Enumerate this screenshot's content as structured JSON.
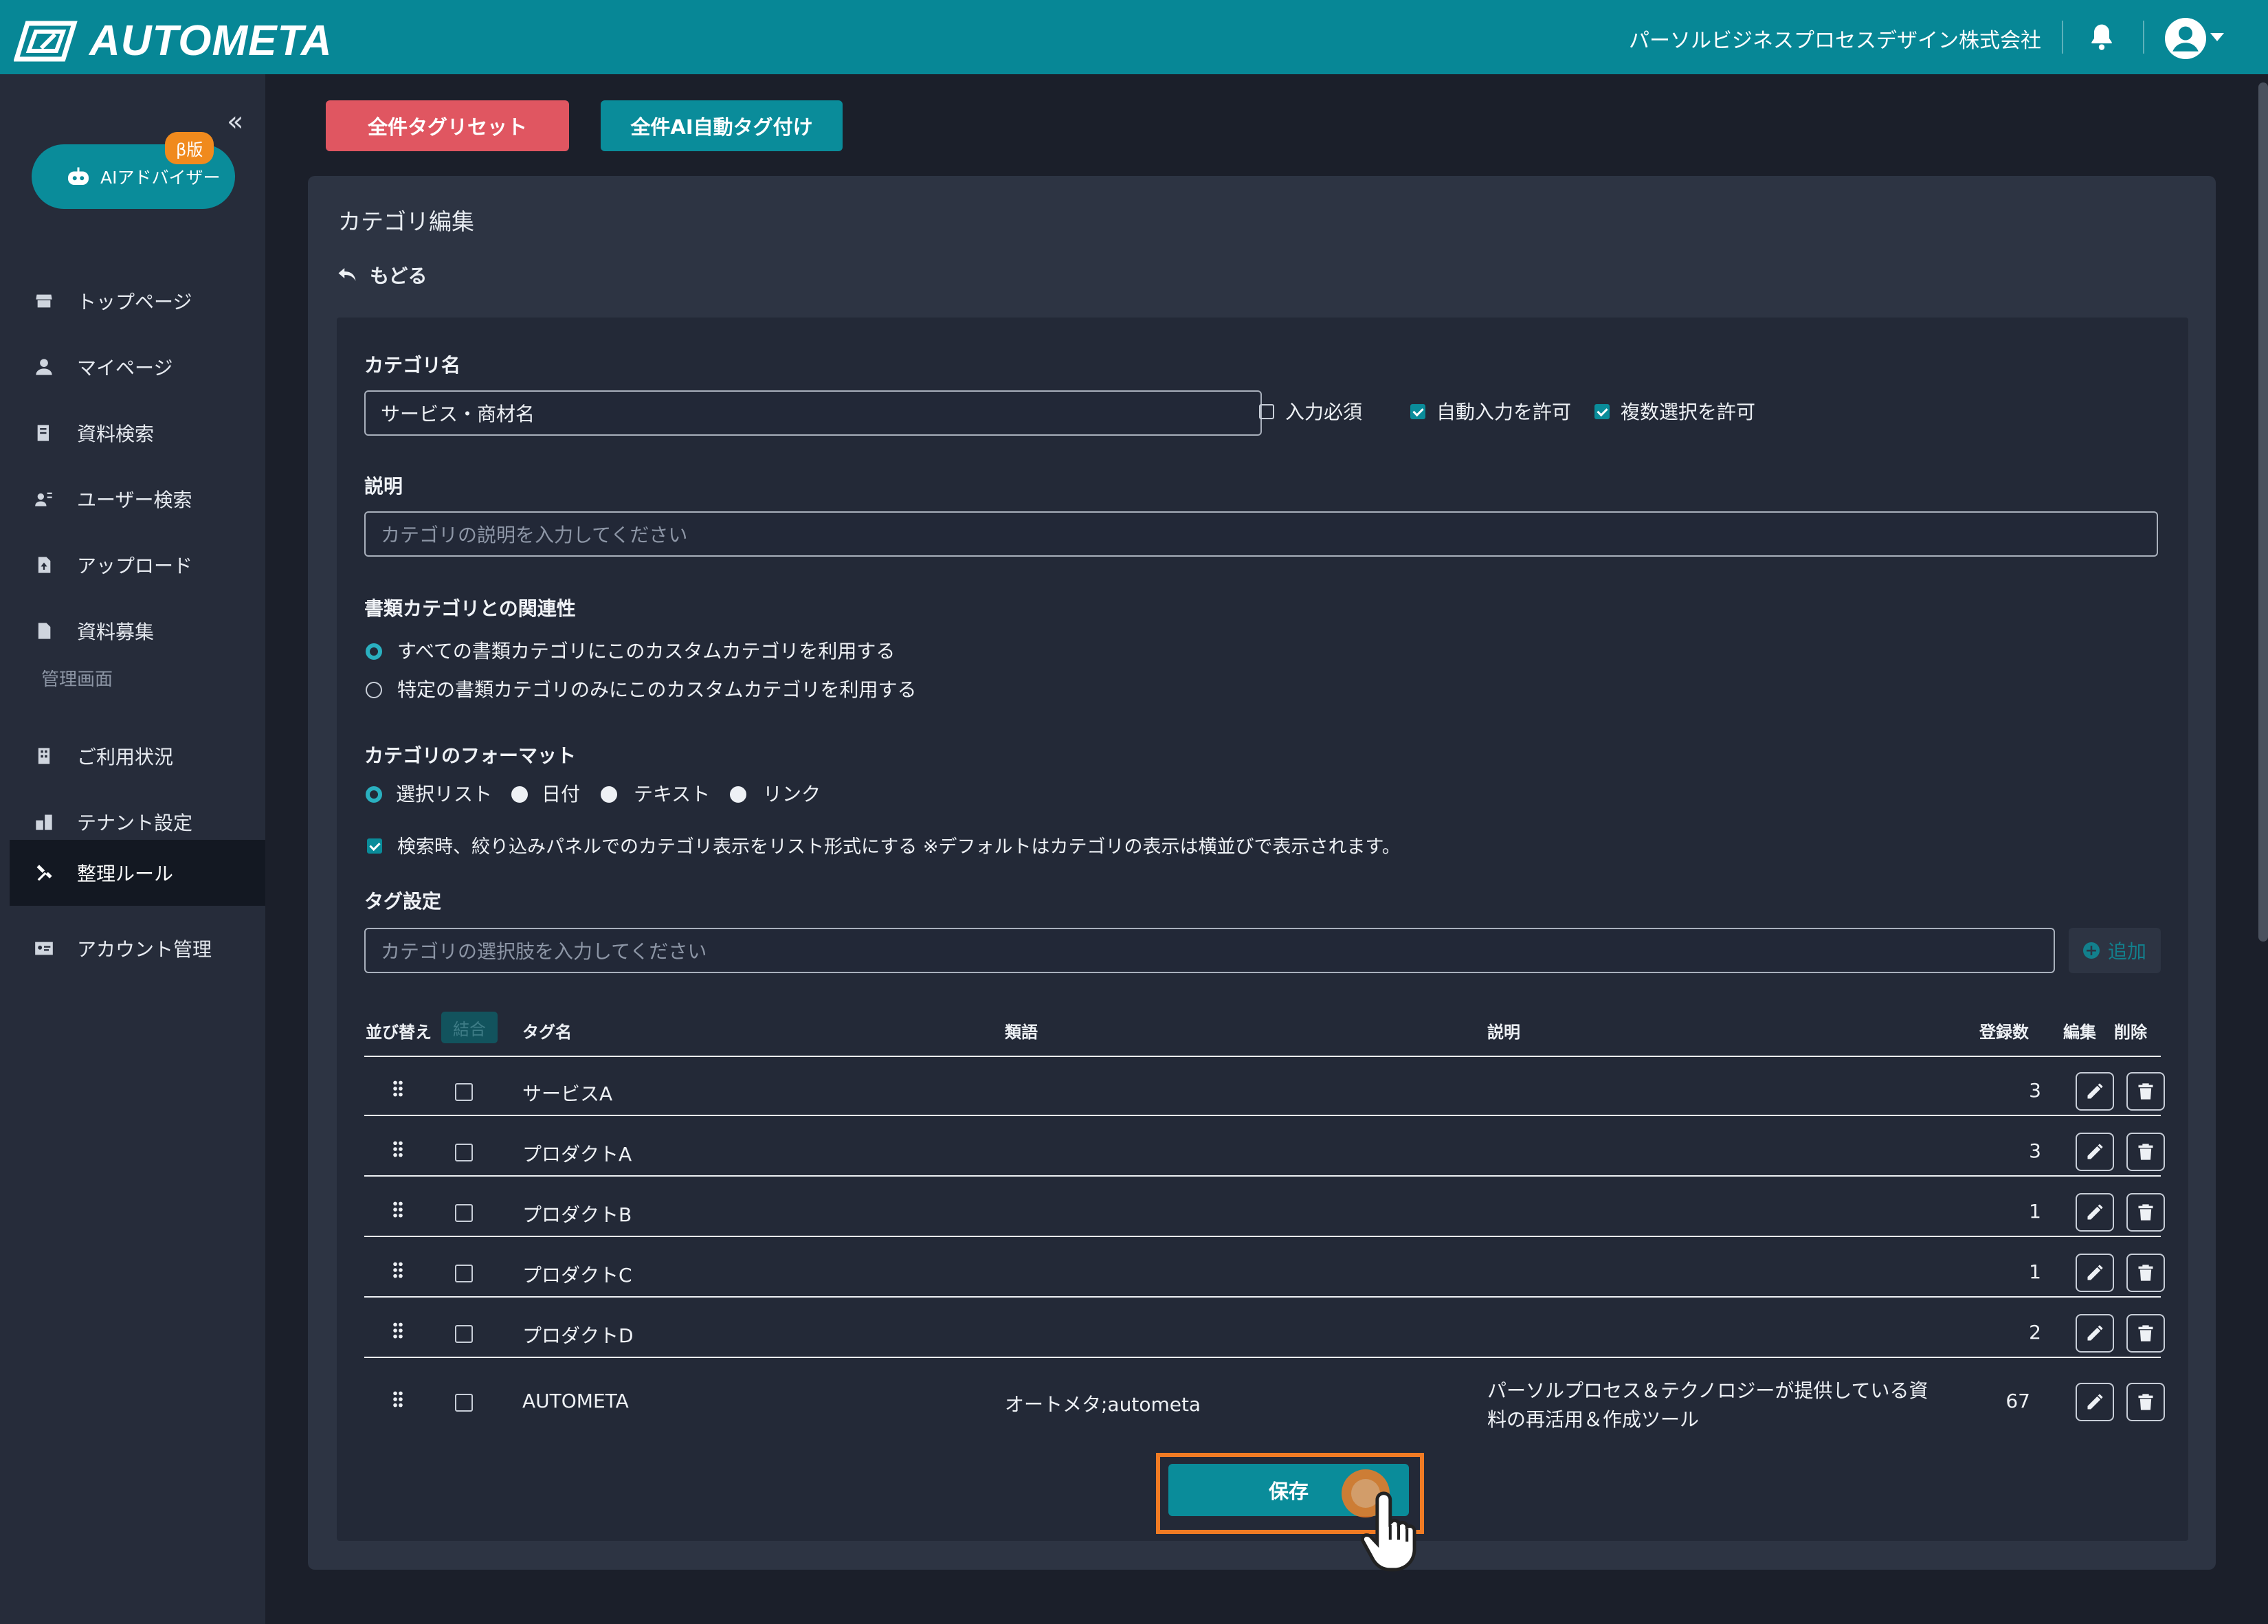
{
  "header": {
    "logo_text": "AUTOMETA",
    "company": "パーソルビジネスプロセスデザイン株式会社"
  },
  "sidebar": {
    "ai_button": "AIアドバイザー",
    "beta_badge": "β版",
    "items": [
      {
        "label": "トップページ"
      },
      {
        "label": "マイページ"
      },
      {
        "label": "資料検索"
      },
      {
        "label": "ユーザー検索"
      },
      {
        "label": "アップロード"
      },
      {
        "label": "資料募集"
      }
    ],
    "admin_section": "管理画面",
    "admin_items": [
      {
        "label": "ご利用状況"
      },
      {
        "label": "テナント設定"
      },
      {
        "label": "整理ルール",
        "active": true
      },
      {
        "label": "アカウント管理"
      }
    ]
  },
  "toolbar": {
    "reset_label": "全件タグリセット",
    "ai_tag_label": "全件AI自動タグ付け"
  },
  "panel": {
    "title": "カテゴリ編集",
    "back": "もどる"
  },
  "form": {
    "category_name_label": "カテゴリ名",
    "category_name_value": "サービス・商材名",
    "required_label": "入力必須",
    "required_checked": false,
    "auto_input_label": "自動入力を許可",
    "auto_input_checked": true,
    "multi_select_label": "複数選択を許可",
    "multi_select_checked": true,
    "description_label": "説明",
    "description_placeholder": "カテゴリの説明を入力してください",
    "relation_label": "書類カテゴリとの関連性",
    "relation_options": [
      {
        "label": "すべての書類カテゴリにこのカスタムカテゴリを利用する",
        "selected": true
      },
      {
        "label": "特定の書類カテゴリのみにこのカスタムカテゴリを利用する",
        "selected": false
      }
    ],
    "format_label": "カテゴリのフォーマット",
    "format_options": [
      {
        "label": "選択リスト",
        "selected": true
      },
      {
        "label": "日付",
        "selected": false
      },
      {
        "label": "テキスト",
        "selected": false
      },
      {
        "label": "リンク",
        "selected": false
      }
    ],
    "list_display_label": "検索時、絞り込みパネルでのカテゴリ表示をリスト形式にする ※デフォルトはカテゴリの表示は横並びで表示されます。",
    "list_display_checked": true,
    "tag_settings_label": "タグ設定",
    "tag_input_placeholder": "カテゴリの選択肢を入力してください",
    "add_label": "追加",
    "save_label": "保存"
  },
  "table": {
    "headers": {
      "sort": "並び替え",
      "merge": "結合",
      "tag_name": "タグ名",
      "synonym": "類語",
      "description": "説明",
      "count": "登録数",
      "edit": "編集",
      "delete": "削除"
    },
    "rows": [
      {
        "tag": "サービスA",
        "synonym": "",
        "description": "",
        "count": "3"
      },
      {
        "tag": "プロダクトA",
        "synonym": "",
        "description": "",
        "count": "3"
      },
      {
        "tag": "プロダクトB",
        "synonym": "",
        "description": "",
        "count": "1"
      },
      {
        "tag": "プロダクトC",
        "synonym": "",
        "description": "",
        "count": "1"
      },
      {
        "tag": "プロダクトD",
        "synonym": "",
        "description": "",
        "count": "2"
      },
      {
        "tag": "AUTOMETA",
        "synonym": "オートメタ;autometa",
        "description_line1": "パーソルプロセス＆テクノロジーが提供している資",
        "description_line2": "料の再活用＆作成ツール",
        "count": "67"
      }
    ]
  },
  "colors": {
    "header": "#078796",
    "sidebar": "#262c3a",
    "panel": "#2d3443",
    "accent": "#0a8c9a",
    "danger": "#e05661",
    "highlight": "#f07b24"
  },
  "icons": [
    "logo-icon",
    "bell-icon",
    "user-icon",
    "ai-robot-icon",
    "store-icon",
    "person-icon",
    "document-search-icon",
    "user-search-icon",
    "upload-icon",
    "file-icon",
    "building-icon",
    "tenant-icon",
    "tools-icon",
    "id-card-icon",
    "back-arrow-icon",
    "drag-handle-icon",
    "pencil-icon",
    "trash-icon",
    "plus-circle-icon",
    "pointer-hand-icon"
  ]
}
